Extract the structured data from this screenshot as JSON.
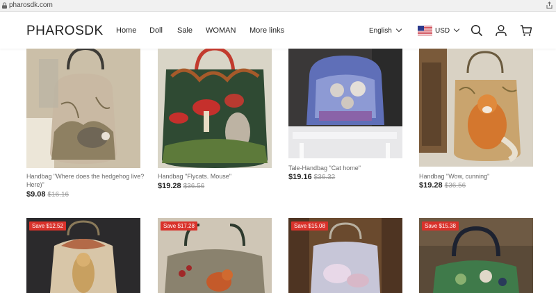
{
  "browser": {
    "url": "pharosdk.com"
  },
  "header": {
    "logo": "PHAROSDK",
    "nav": [
      "Home",
      "Doll",
      "Sale",
      "WOMAN",
      "More links"
    ],
    "language": "English",
    "currency": "USD"
  },
  "products": [
    {
      "title": "Handbag \"Where does the hedgehog live? Here)\"",
      "price": "$9.08",
      "old_price": "$16.16"
    },
    {
      "title": "Handbag \"Flycats. Mouse\"",
      "price": "$19.28",
      "old_price": "$36.56"
    },
    {
      "title": "Tale-Handbag \"Cat home\"",
      "price": "$19.16",
      "old_price": "$36.32"
    },
    {
      "title": "Handbag \"Wow, cunning\"",
      "price": "$19.28",
      "old_price": "$36.56"
    }
  ],
  "badges": [
    "Save $12.52",
    "Save $17.28",
    "Save $15.08",
    "Save $15.38"
  ]
}
